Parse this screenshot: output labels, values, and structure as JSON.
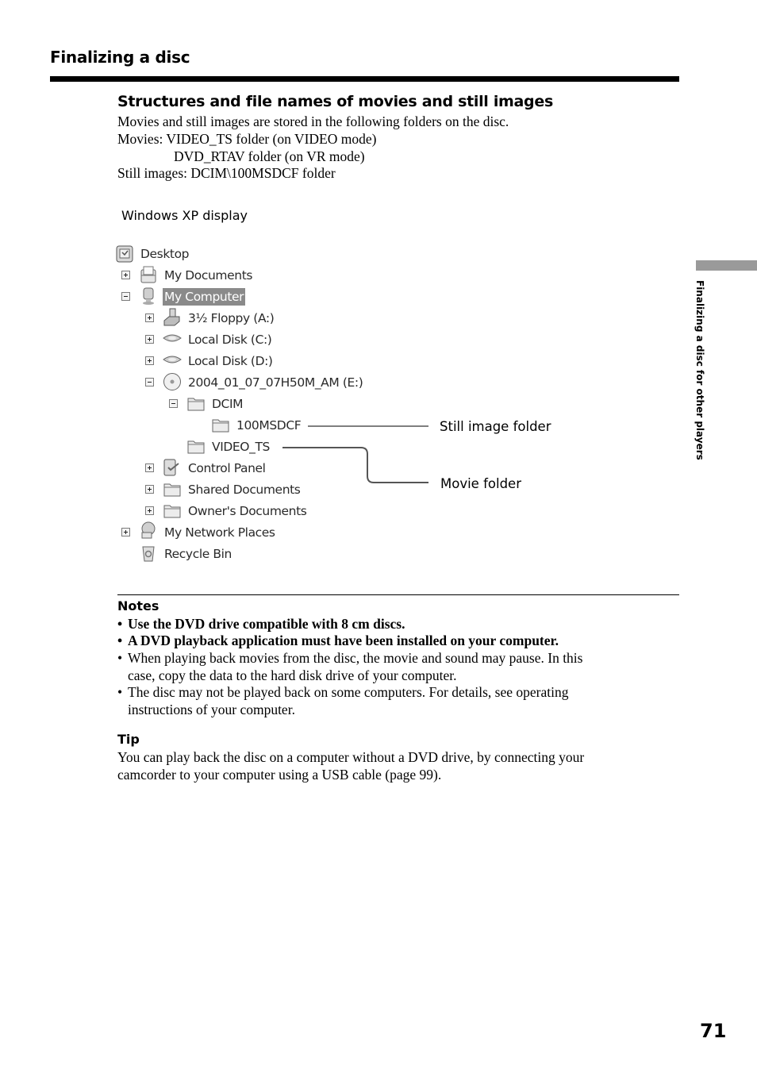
{
  "header": {
    "section_title": "Finalizing a disc"
  },
  "content": {
    "subheading": "Structures and file names of movies and still images",
    "intro": "Movies and still images are stored in the following folders on the disc.",
    "movies_line1": "Movies:  VIDEO_TS folder (on VIDEO mode)",
    "movies_line2": "DVD_RTAV folder (on VR mode)",
    "stills_line": "Still images: DCIM\\100MSDCF folder",
    "figure_caption": "Windows XP display"
  },
  "tree": {
    "items": [
      {
        "label": "Desktop",
        "icon": "desktop-icon",
        "expander": "none",
        "selected": false
      },
      {
        "label": "My Documents",
        "icon": "my-documents-icon",
        "expander": "plus",
        "selected": false
      },
      {
        "label": "My Computer",
        "icon": "my-computer-icon",
        "expander": "minus",
        "selected": true
      },
      {
        "label": "3½ Floppy (A:)",
        "icon": "floppy-drive-icon",
        "expander": "plus",
        "selected": false
      },
      {
        "label": "Local Disk (C:)",
        "icon": "hard-disk-icon",
        "expander": "plus",
        "selected": false
      },
      {
        "label": "Local Disk (D:)",
        "icon": "hard-disk-icon",
        "expander": "plus",
        "selected": false
      },
      {
        "label": "2004_01_07_07H50M_AM (E:)",
        "icon": "dvd-disc-icon",
        "expander": "minus",
        "selected": false
      },
      {
        "label": "DCIM",
        "icon": "folder-icon",
        "expander": "minus",
        "selected": false
      },
      {
        "label": "100MSDCF",
        "icon": "folder-icon",
        "expander": "none",
        "selected": false
      },
      {
        "label": "VIDEO_TS",
        "icon": "folder-icon",
        "expander": "none",
        "selected": false
      },
      {
        "label": "Control Panel",
        "icon": "control-panel-icon",
        "expander": "plus",
        "selected": false
      },
      {
        "label": "Shared Documents",
        "icon": "folder-icon",
        "expander": "plus",
        "selected": false
      },
      {
        "label": "Owner's Documents",
        "icon": "folder-icon",
        "expander": "plus",
        "selected": false
      },
      {
        "label": "My Network Places",
        "icon": "network-places-icon",
        "expander": "plus",
        "selected": false
      },
      {
        "label": "Recycle Bin",
        "icon": "recycle-bin-icon",
        "expander": "none",
        "selected": false
      }
    ]
  },
  "callouts": {
    "still_image": "Still image folder",
    "movie": "Movie folder"
  },
  "notes": {
    "heading": "Notes",
    "bullet1": "Use the DVD drive compatible with 8 cm discs.",
    "bullet2": "A DVD playback application must have been installed on your computer.",
    "bullet3_line1": "When playing back movies from the disc, the movie and sound may pause. In this",
    "bullet3_line2": "case, copy the data to the hard disk drive of your computer.",
    "bullet4_line1": "The disc may not be played back on some computers. For details, see operating",
    "bullet4_line2": "instructions of your computer.",
    "bullet_char": "•"
  },
  "tip": {
    "heading": "Tip",
    "line1": "You can play back the disc on a computer without a DVD drive, by connecting your",
    "line2": "camcorder to your computer using a USB cable (page 99)."
  },
  "sidebar": {
    "chapter_label": "Finalizing a disc for other players"
  },
  "footer": {
    "page_number": "71"
  }
}
